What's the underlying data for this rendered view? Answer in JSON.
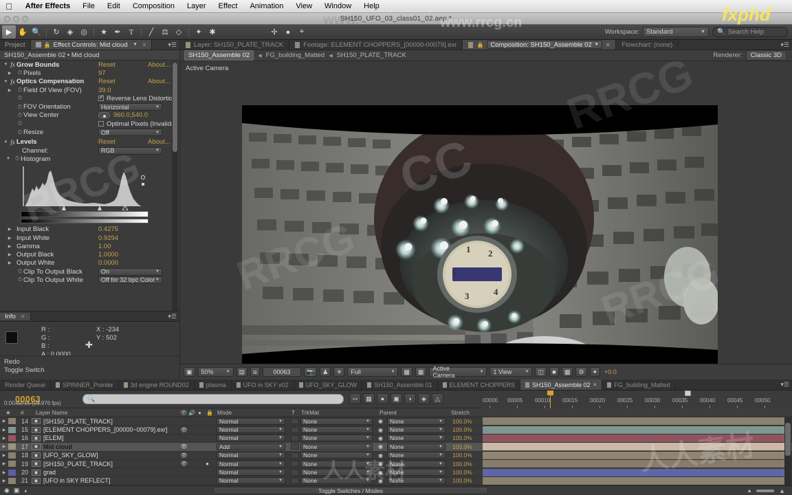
{
  "mac_menu": {
    "apple": "",
    "items": [
      "After Effects",
      "File",
      "Edit",
      "Composition",
      "Layer",
      "Effect",
      "Animation",
      "View",
      "Window",
      "Help"
    ]
  },
  "window": {
    "title": "SH150_UFO_03_class01_02.aep *"
  },
  "toolbar": {
    "workspace_label": "Workspace:",
    "workspace_value": "Standard",
    "search_placeholder": "Search Help"
  },
  "left_panel": {
    "tabs": [
      {
        "label": "Project",
        "selected": false
      },
      {
        "label": "Effect Controls: Mid cloud",
        "selected": true
      }
    ],
    "header": "SH150_Assemble 02 • Mid cloud",
    "effects": [
      {
        "name": "Grow Bounds",
        "reset": "Reset",
        "about": "About..."
      },
      {
        "name": "Pixels",
        "value": "97",
        "child": true
      },
      {
        "name": "Optics Compensation",
        "reset": "Reset",
        "about": "About..."
      },
      {
        "name": "Field Of View (FOV)",
        "value": "39.0",
        "child": true
      },
      {
        "name": "Reverse Lens Distortion",
        "checkbox": true,
        "checked": true
      },
      {
        "name": "FOV Orientation",
        "select": "Horizontal"
      },
      {
        "name": "View Center",
        "point": "960.0,540.0"
      },
      {
        "name": "Optimal Pixels (Invalidat",
        "checkbox": true,
        "checked": false
      },
      {
        "name": "Resize",
        "select": "Off"
      },
      {
        "name": "Levels",
        "reset": "Reset",
        "about": "About..."
      },
      {
        "name": "Channel:",
        "select": "RGB"
      },
      {
        "name": "Histogram"
      }
    ],
    "levels_params": [
      {
        "label": "Input Black",
        "value": "0.4275"
      },
      {
        "label": "Input White",
        "value": "0.9294"
      },
      {
        "label": "Gamma",
        "value": "1.00"
      },
      {
        "label": "Output Black",
        "value": "1.0000"
      },
      {
        "label": "Output White",
        "value": "0.0000"
      }
    ],
    "levels_clips": [
      {
        "label": "Clip To Output Black",
        "value": "On"
      },
      {
        "label": "Clip To Output White",
        "value": "Off for 32 bpc Color"
      }
    ]
  },
  "info_panel": {
    "tab": "Info",
    "r": "R :",
    "g": "G :",
    "b": "B :",
    "a": "A : 0.0000",
    "x": "X : -234",
    "y": "Y : 502",
    "history": [
      "Redo",
      "Toggle Switch"
    ]
  },
  "viewer": {
    "tabs": [
      {
        "label": "Layer: SH150_PLATE_TRACK",
        "selected": false
      },
      {
        "label": "Footage: ELEMENT CHOPPERS_[00000-00079].exr",
        "selected": false
      },
      {
        "label": "Composition: SH150_Assemble 02",
        "selected": true
      },
      {
        "label": "Flowchart: (none)",
        "selected": false
      }
    ],
    "breadcrumb": [
      "SH150_Assemble 02",
      "FG_building_Matted",
      "SH150_PLATE_TRACK"
    ],
    "renderer_label": "Renderer:",
    "renderer_value": "Classic 3D",
    "camera_label": "Active Camera",
    "bottom": {
      "zoom": "50%",
      "frame": "00063",
      "resolution": "Full",
      "view_camera": "Active Camera",
      "view_count": "1 View",
      "exposure": "+0.0"
    }
  },
  "timeline": {
    "tabs": [
      {
        "label": "Render Queue",
        "selected": false,
        "swatch": false
      },
      {
        "label": "SPINNER_Pointer",
        "selected": false,
        "swatch": true
      },
      {
        "label": "3d engine ROUND02",
        "selected": false,
        "swatch": true
      },
      {
        "label": "plasma",
        "selected": false,
        "swatch": true
      },
      {
        "label": "UFO in SKY v02",
        "selected": false,
        "swatch": true
      },
      {
        "label": "UFO_SKY_GLOW",
        "selected": false,
        "swatch": true
      },
      {
        "label": "SH150_Assemble 01",
        "selected": false,
        "swatch": true
      },
      {
        "label": "ELEMENT CHOPPERS",
        "selected": false,
        "swatch": true
      },
      {
        "label": "SH150_Assemble 02",
        "selected": true,
        "swatch": true
      },
      {
        "label": "FG_building_Matted",
        "selected": false,
        "swatch": true
      }
    ],
    "timecode": "00063",
    "timecode_sub": "0:00:02:15 (23.976 fps)",
    "search_placeholder": "",
    "columns": [
      "#",
      "Layer Name",
      "Mode",
      "T",
      "TrkMat",
      "Parent",
      "Stretch"
    ],
    "ruler_ticks": [
      "00000",
      "00005",
      "00010",
      "00015",
      "00020",
      "00025",
      "00030",
      "00035",
      "00040",
      "00045",
      "00050"
    ],
    "layers": [
      {
        "num": "14",
        "name": "[SH150_PLATE_TRACK]",
        "mode": "Normal",
        "trkmat": "None",
        "parent": "None",
        "stretch": "100.0%",
        "color": "#8a8170",
        "bar": "#8a8170",
        "selected": false,
        "eye": false,
        "solo": false
      },
      {
        "num": "15",
        "name": "[ELEMENT CHOPPERS_[00000~00079].exr]",
        "mode": "Normal",
        "trkmat": "None",
        "parent": "None",
        "stretch": "100.0%",
        "color": "#7e978f",
        "bar": "#7e978f",
        "selected": false,
        "eye": true,
        "solo": false
      },
      {
        "num": "16",
        "name": "[ELEM]",
        "mode": "Normal",
        "trkmat": "None",
        "parent": "None",
        "stretch": "100.0%",
        "color": "#9a5560",
        "bar": "#8d5560",
        "selected": false,
        "eye": false,
        "solo": false
      },
      {
        "num": "17",
        "name": "Mid cloud",
        "mode": "Add",
        "trkmat": "None",
        "parent": "None",
        "stretch": "100.0%",
        "color": "#9c937f",
        "bar": "#cdb8a8",
        "selected": true,
        "eye": true,
        "solo": false
      },
      {
        "num": "18",
        "name": "[UFO_SKY_GLOW]",
        "mode": "Normal",
        "trkmat": "None",
        "parent": "None",
        "stretch": "100.0%",
        "color": "#8a8170",
        "bar": "#8e8572",
        "selected": false,
        "eye": true,
        "solo": false
      },
      {
        "num": "19",
        "name": "[SH150_PLATE_TRACK]",
        "mode": "Normal",
        "trkmat": "None",
        "parent": "None",
        "stretch": "100.0%",
        "color": "#8a8170",
        "bar": "#867c6c",
        "selected": false,
        "eye": true,
        "solo": true
      },
      {
        "num": "20",
        "name": "grad",
        "mode": "Normal",
        "trkmat": "None",
        "parent": "None",
        "stretch": "100.0%",
        "color": "#5a5fa8",
        "bar": "#6065a8",
        "selected": false,
        "eye": false,
        "solo": false
      },
      {
        "num": "21",
        "name": "[UFO in SKY REFLECT]",
        "mode": "Normal",
        "trkmat": "None",
        "parent": "None",
        "stretch": "100.0%",
        "color": "#8a8170",
        "bar": "#8a8170",
        "selected": false,
        "eye": false,
        "solo": false
      }
    ],
    "toggle_button": "Toggle Switches / Modes"
  },
  "colors": {
    "accent_orange": "#c8a04a",
    "timecode_orange": "#d8a32e",
    "panel_bg": "#3b3b3b",
    "selected_row": "#555555"
  }
}
